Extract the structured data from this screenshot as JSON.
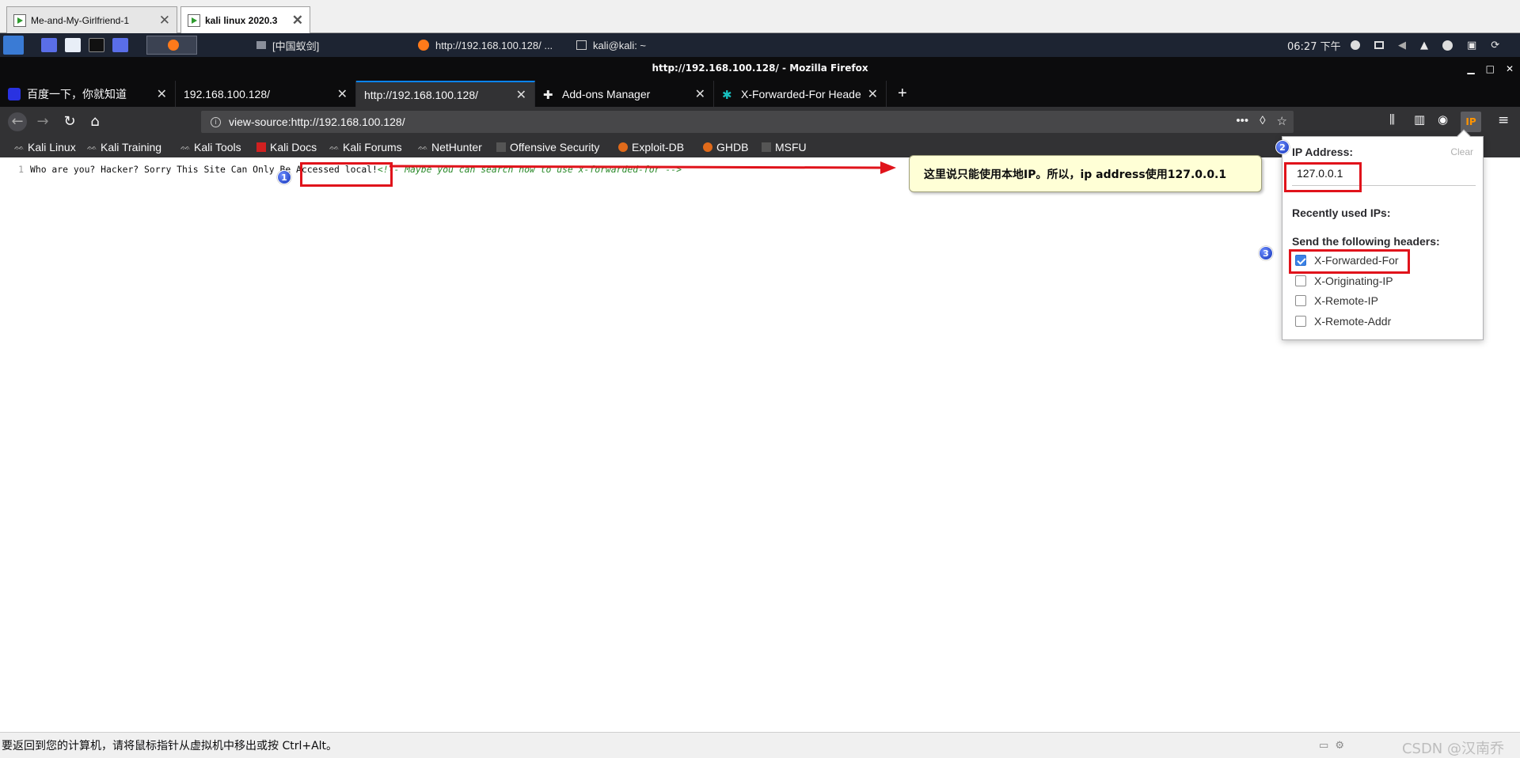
{
  "vm_tabs": [
    {
      "label": "Me-and-My-Girlfriend-1"
    },
    {
      "label": "kali linux 2020.3"
    }
  ],
  "panel": {
    "task_window": "[中国蚁剑]",
    "task_firefox": "http://192.168.100.128/ ...",
    "task_terminal": "kali@kali: ~",
    "clock": "06:27 下午"
  },
  "window_title": "http://192.168.100.128/ - Mozilla Firefox",
  "browser_tabs": [
    {
      "label": "百度一下，你就知道"
    },
    {
      "label": "192.168.100.128/"
    },
    {
      "label": "http://192.168.100.128/"
    },
    {
      "label": "Add-ons Manager"
    },
    {
      "label": "X-Forwarded-For Heade"
    }
  ],
  "url": "view-source:http://192.168.100.128/",
  "bookmarks": [
    "Kali Linux",
    "Kali Training",
    "Kali Tools",
    "Kali Docs",
    "Kali Forums",
    "NetHunter",
    "Offensive Security",
    "Exploit-DB",
    "GHDB",
    "MSFU"
  ],
  "source": {
    "line_number": "1",
    "text": "Who are you? Hacker? Sorry This Site Can Only Be Accessed local!",
    "comment": "<!-- Maybe you can search how to use x-forwarded-for -->"
  },
  "annotations": {
    "badge1": "1",
    "badge2": "2",
    "badge3": "3",
    "callout": "这里说只能使用本地IP。所以，ip address使用127.0.0.1"
  },
  "popup": {
    "ip_label": "IP Address:",
    "clear": "Clear",
    "ip_value": "127.0.0.1",
    "recent_label": "Recently used IPs:",
    "headers_label": "Send the following headers:",
    "headers": [
      {
        "name": "X-Forwarded-For",
        "checked": true
      },
      {
        "name": "X-Originating-IP",
        "checked": false
      },
      {
        "name": "X-Remote-IP",
        "checked": false
      },
      {
        "name": "X-Remote-Addr",
        "checked": false
      }
    ],
    "toolbar_button": "IP"
  },
  "status_bar": {
    "hint": "要返回到您的计算机，请将鼠标指针从虚拟机中移出或按 Ctrl+Alt。",
    "watermark": "CSDN @汉南乔"
  },
  "colors": {
    "annotation_red": "#e0131b",
    "callout_bg": "#ffffd6",
    "firefox_dark": "#0c0c0d",
    "accent_blue": "#0a84ff"
  }
}
